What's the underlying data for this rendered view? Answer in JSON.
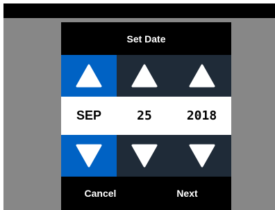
{
  "dialog": {
    "title": "Set Date",
    "month": "SEP",
    "day": "25",
    "year": "2018",
    "cancel_label": "Cancel",
    "next_label": "Next"
  },
  "icons": {
    "increment": "triangle-up-icon",
    "decrement": "triangle-down-icon"
  },
  "colors": {
    "active_column": "#0062c4",
    "inactive_column": "#1f2b38",
    "dialog_bg": "#000000",
    "backdrop": "#878787"
  }
}
